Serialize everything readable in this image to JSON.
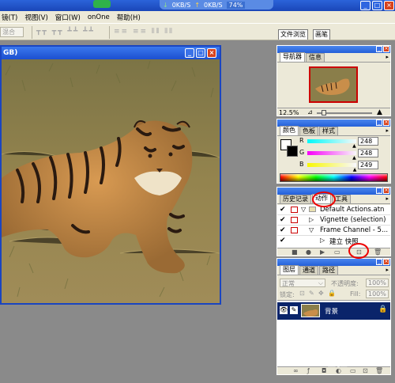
{
  "titlebar": {
    "net_down": "0KB/S",
    "net_up": "0KB/S",
    "net_pct": "74%",
    "min": "_",
    "max": "□",
    "close": "×"
  },
  "menu": [
    {
      "label": "镜(T)"
    },
    {
      "label": "视图(V)"
    },
    {
      "label": "窗口(W)"
    },
    {
      "label": "onOne"
    },
    {
      "label": "帮助(H)"
    }
  ],
  "options": {
    "field_placeholder": "混合",
    "icons_a": "┳┳ ┳┳ ┻┻ ┻┻",
    "icons_b": "≡≡ ≡≡ ⫴⫴ ⫴⫴",
    "well_tabs": [
      "文件浏览",
      "画笔"
    ]
  },
  "document": {
    "title": "GB)",
    "buttons": [
      "_",
      "□",
      "×"
    ]
  },
  "navigator": {
    "tabs": [
      "导航器",
      "信息"
    ],
    "zoom": "12.5%"
  },
  "color": {
    "tabs": [
      "颜色",
      "色板",
      "样式"
    ],
    "channels": [
      {
        "label": "R",
        "value": "248",
        "level": 0.97
      },
      {
        "label": "G",
        "value": "248",
        "level": 0.97
      },
      {
        "label": "B",
        "value": "249",
        "level": 0.98
      }
    ]
  },
  "actions": {
    "tabs": [
      "历史记录",
      "动作",
      "工具"
    ],
    "rows": [
      {
        "label": "Default Actions.atn",
        "kind": "folder"
      },
      {
        "label": "Vignette (selection)",
        "kind": "action"
      },
      {
        "label": "Frame Channel - 5...",
        "kind": "action-open"
      },
      {
        "label": "建立 快照",
        "kind": "step"
      }
    ]
  },
  "layers": {
    "tabs": [
      "图层",
      "通道",
      "路径"
    ],
    "blend_mode": "正常",
    "opacity_label": "不透明度:",
    "opacity": "100%",
    "lock_label": "锁定:",
    "fill_label": "Fill:",
    "fill": "100%",
    "layer_name": "背景"
  },
  "watermark": "Bai 经验"
}
